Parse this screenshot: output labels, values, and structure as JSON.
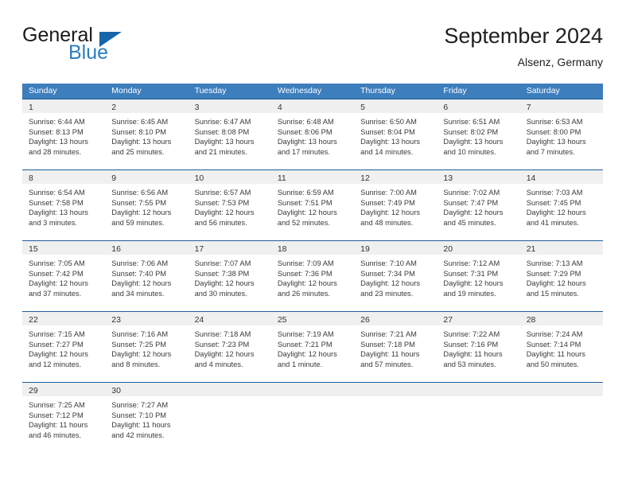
{
  "brand": {
    "name_part1": "General",
    "name_part2": "Blue",
    "logo_icon": "triangle-flag-icon"
  },
  "header": {
    "title": "September 2024",
    "subtitle": "Alsenz, Germany"
  },
  "weekdays": [
    "Sunday",
    "Monday",
    "Tuesday",
    "Wednesday",
    "Thursday",
    "Friday",
    "Saturday"
  ],
  "colors": {
    "header_blue": "#3d7ebd",
    "row_border_blue": "#1f5c9e",
    "day_bar_gray": "#f0f0f0",
    "brand_blue": "#2b7cc0",
    "logo_blue": "#1665aa"
  },
  "weeks": [
    [
      {
        "day": "1",
        "lines": [
          "Sunrise: 6:44 AM",
          "Sunset: 8:13 PM",
          "Daylight: 13 hours",
          "and 28 minutes."
        ]
      },
      {
        "day": "2",
        "lines": [
          "Sunrise: 6:45 AM",
          "Sunset: 8:10 PM",
          "Daylight: 13 hours",
          "and 25 minutes."
        ]
      },
      {
        "day": "3",
        "lines": [
          "Sunrise: 6:47 AM",
          "Sunset: 8:08 PM",
          "Daylight: 13 hours",
          "and 21 minutes."
        ]
      },
      {
        "day": "4",
        "lines": [
          "Sunrise: 6:48 AM",
          "Sunset: 8:06 PM",
          "Daylight: 13 hours",
          "and 17 minutes."
        ]
      },
      {
        "day": "5",
        "lines": [
          "Sunrise: 6:50 AM",
          "Sunset: 8:04 PM",
          "Daylight: 13 hours",
          "and 14 minutes."
        ]
      },
      {
        "day": "6",
        "lines": [
          "Sunrise: 6:51 AM",
          "Sunset: 8:02 PM",
          "Daylight: 13 hours",
          "and 10 minutes."
        ]
      },
      {
        "day": "7",
        "lines": [
          "Sunrise: 6:53 AM",
          "Sunset: 8:00 PM",
          "Daylight: 13 hours",
          "and 7 minutes."
        ]
      }
    ],
    [
      {
        "day": "8",
        "lines": [
          "Sunrise: 6:54 AM",
          "Sunset: 7:58 PM",
          "Daylight: 13 hours",
          "and 3 minutes."
        ]
      },
      {
        "day": "9",
        "lines": [
          "Sunrise: 6:56 AM",
          "Sunset: 7:55 PM",
          "Daylight: 12 hours",
          "and 59 minutes."
        ]
      },
      {
        "day": "10",
        "lines": [
          "Sunrise: 6:57 AM",
          "Sunset: 7:53 PM",
          "Daylight: 12 hours",
          "and 56 minutes."
        ]
      },
      {
        "day": "11",
        "lines": [
          "Sunrise: 6:59 AM",
          "Sunset: 7:51 PM",
          "Daylight: 12 hours",
          "and 52 minutes."
        ]
      },
      {
        "day": "12",
        "lines": [
          "Sunrise: 7:00 AM",
          "Sunset: 7:49 PM",
          "Daylight: 12 hours",
          "and 48 minutes."
        ]
      },
      {
        "day": "13",
        "lines": [
          "Sunrise: 7:02 AM",
          "Sunset: 7:47 PM",
          "Daylight: 12 hours",
          "and 45 minutes."
        ]
      },
      {
        "day": "14",
        "lines": [
          "Sunrise: 7:03 AM",
          "Sunset: 7:45 PM",
          "Daylight: 12 hours",
          "and 41 minutes."
        ]
      }
    ],
    [
      {
        "day": "15",
        "lines": [
          "Sunrise: 7:05 AM",
          "Sunset: 7:42 PM",
          "Daylight: 12 hours",
          "and 37 minutes."
        ]
      },
      {
        "day": "16",
        "lines": [
          "Sunrise: 7:06 AM",
          "Sunset: 7:40 PM",
          "Daylight: 12 hours",
          "and 34 minutes."
        ]
      },
      {
        "day": "17",
        "lines": [
          "Sunrise: 7:07 AM",
          "Sunset: 7:38 PM",
          "Daylight: 12 hours",
          "and 30 minutes."
        ]
      },
      {
        "day": "18",
        "lines": [
          "Sunrise: 7:09 AM",
          "Sunset: 7:36 PM",
          "Daylight: 12 hours",
          "and 26 minutes."
        ]
      },
      {
        "day": "19",
        "lines": [
          "Sunrise: 7:10 AM",
          "Sunset: 7:34 PM",
          "Daylight: 12 hours",
          "and 23 minutes."
        ]
      },
      {
        "day": "20",
        "lines": [
          "Sunrise: 7:12 AM",
          "Sunset: 7:31 PM",
          "Daylight: 12 hours",
          "and 19 minutes."
        ]
      },
      {
        "day": "21",
        "lines": [
          "Sunrise: 7:13 AM",
          "Sunset: 7:29 PM",
          "Daylight: 12 hours",
          "and 15 minutes."
        ]
      }
    ],
    [
      {
        "day": "22",
        "lines": [
          "Sunrise: 7:15 AM",
          "Sunset: 7:27 PM",
          "Daylight: 12 hours",
          "and 12 minutes."
        ]
      },
      {
        "day": "23",
        "lines": [
          "Sunrise: 7:16 AM",
          "Sunset: 7:25 PM",
          "Daylight: 12 hours",
          "and 8 minutes."
        ]
      },
      {
        "day": "24",
        "lines": [
          "Sunrise: 7:18 AM",
          "Sunset: 7:23 PM",
          "Daylight: 12 hours",
          "and 4 minutes."
        ]
      },
      {
        "day": "25",
        "lines": [
          "Sunrise: 7:19 AM",
          "Sunset: 7:21 PM",
          "Daylight: 12 hours",
          "and 1 minute."
        ]
      },
      {
        "day": "26",
        "lines": [
          "Sunrise: 7:21 AM",
          "Sunset: 7:18 PM",
          "Daylight: 11 hours",
          "and 57 minutes."
        ]
      },
      {
        "day": "27",
        "lines": [
          "Sunrise: 7:22 AM",
          "Sunset: 7:16 PM",
          "Daylight: 11 hours",
          "and 53 minutes."
        ]
      },
      {
        "day": "28",
        "lines": [
          "Sunrise: 7:24 AM",
          "Sunset: 7:14 PM",
          "Daylight: 11 hours",
          "and 50 minutes."
        ]
      }
    ],
    [
      {
        "day": "29",
        "lines": [
          "Sunrise: 7:25 AM",
          "Sunset: 7:12 PM",
          "Daylight: 11 hours",
          "and 46 minutes."
        ]
      },
      {
        "day": "30",
        "lines": [
          "Sunrise: 7:27 AM",
          "Sunset: 7:10 PM",
          "Daylight: 11 hours",
          "and 42 minutes."
        ]
      },
      {
        "day": "",
        "lines": []
      },
      {
        "day": "",
        "lines": []
      },
      {
        "day": "",
        "lines": []
      },
      {
        "day": "",
        "lines": []
      },
      {
        "day": "",
        "lines": []
      }
    ]
  ]
}
